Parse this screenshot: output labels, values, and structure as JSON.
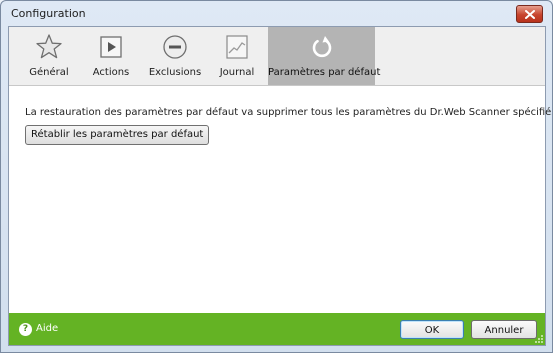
{
  "window": {
    "title": "Configuration"
  },
  "toolbar": {
    "tabs": [
      {
        "label": "Général",
        "icon": "star-icon",
        "active": false
      },
      {
        "label": "Actions",
        "icon": "play-icon",
        "active": false
      },
      {
        "label": "Exclusions",
        "icon": "minus-circle-icon",
        "active": false
      },
      {
        "label": "Journal",
        "icon": "log-chart-icon",
        "active": false
      },
      {
        "label": "Paramètres par défaut",
        "icon": "reset-arrow-icon",
        "active": true
      }
    ]
  },
  "main": {
    "message": "La restauration des paramètres par défaut va supprimer tous les paramètres du Dr.Web Scanner spécifiés par l'utilisateur.",
    "reset_button": "Rétablir les paramètres par défaut"
  },
  "footer": {
    "help_label": "Aide",
    "ok_label": "OK",
    "cancel_label": "Annuler"
  },
  "colors": {
    "footer_bg": "#64b324",
    "active_tab_bg": "#b4b4b4",
    "close_button": "#c7442d"
  }
}
